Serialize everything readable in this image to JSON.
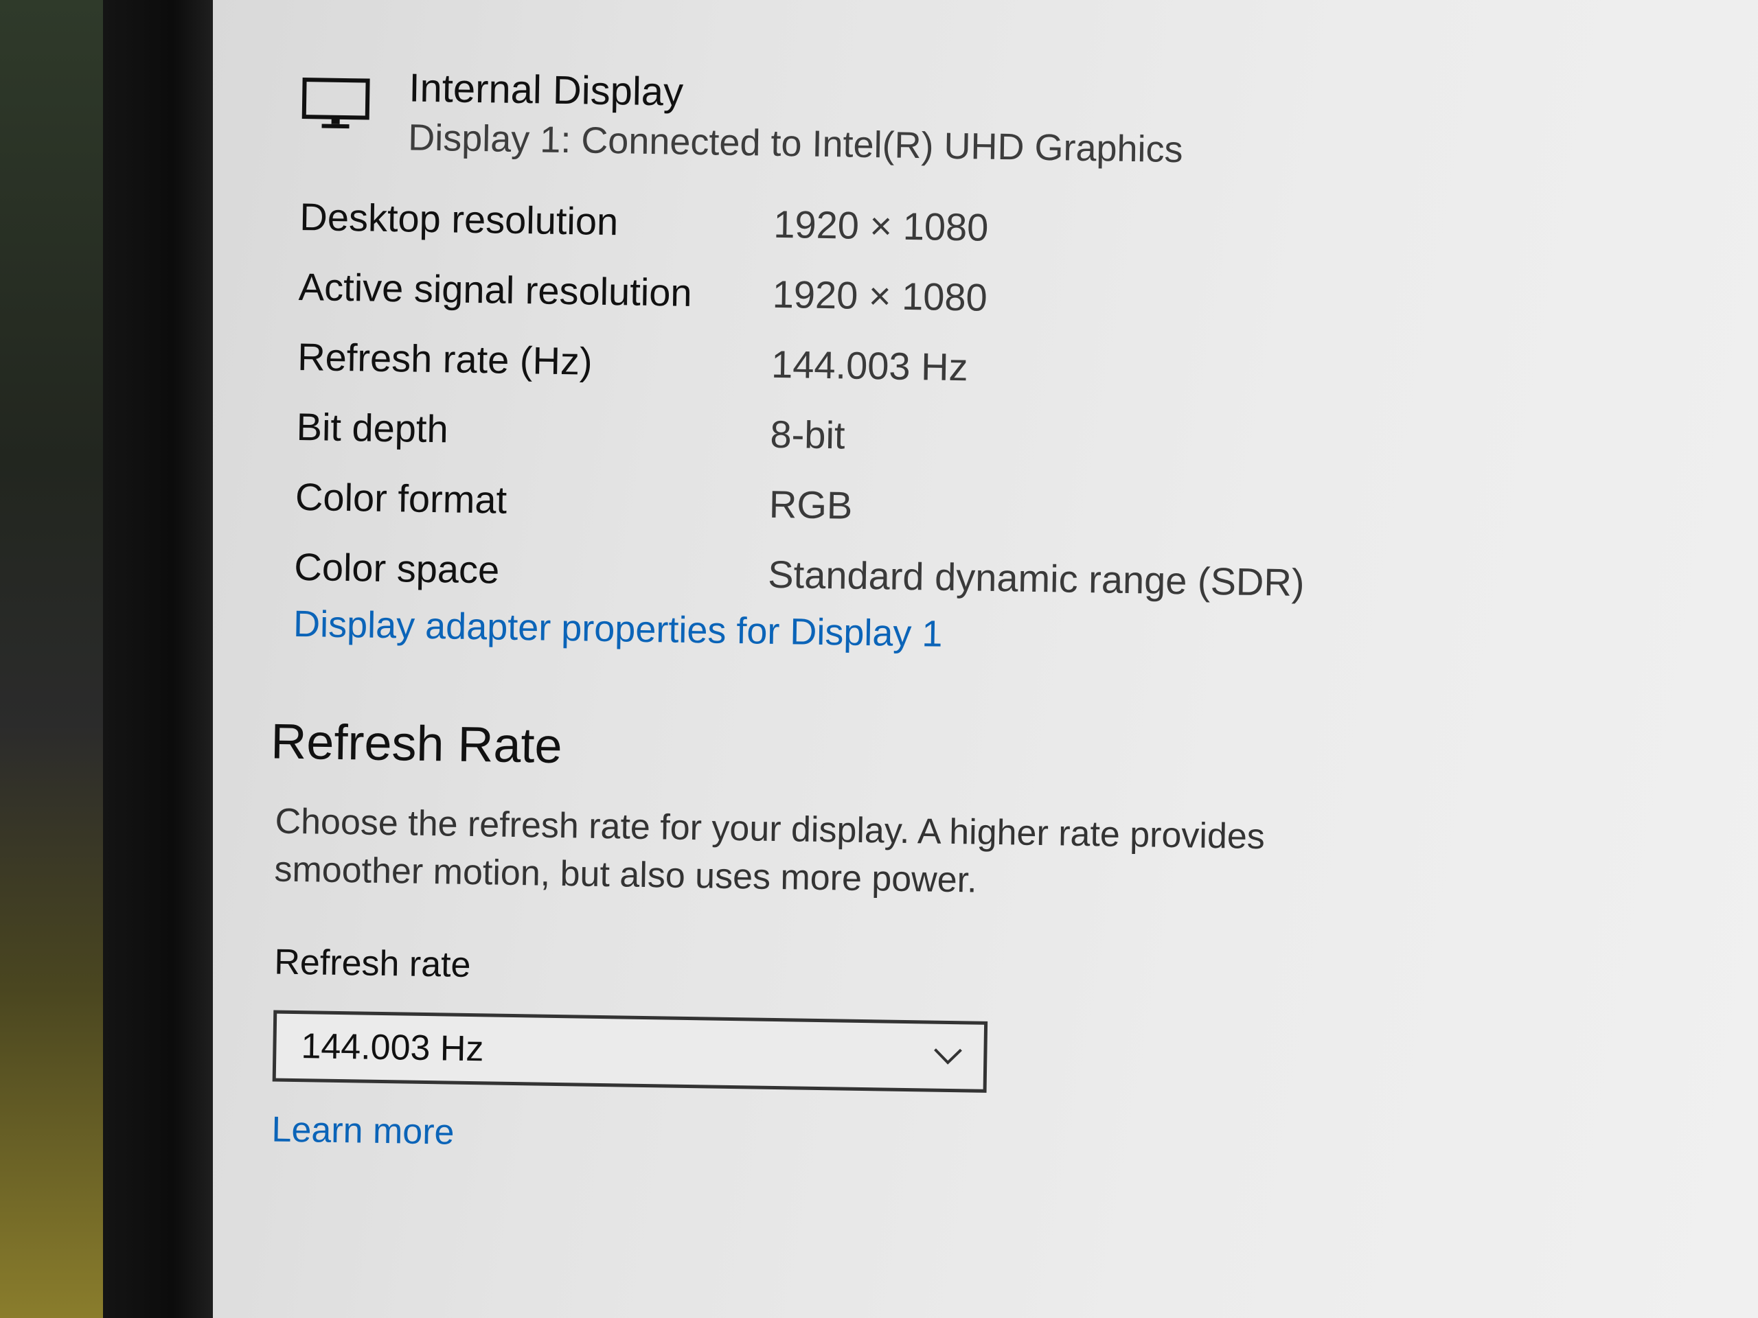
{
  "display": {
    "title": "Internal Display",
    "subtitle": "Display 1: Connected to Intel(R) UHD Graphics",
    "icon": "monitor-icon"
  },
  "properties": [
    {
      "label": "Desktop resolution",
      "value": "1920 × 1080"
    },
    {
      "label": "Active signal resolution",
      "value": "1920 × 1080"
    },
    {
      "label": "Refresh rate (Hz)",
      "value": "144.003 Hz"
    },
    {
      "label": "Bit depth",
      "value": "8-bit"
    },
    {
      "label": "Color format",
      "value": "RGB"
    },
    {
      "label": "Color space",
      "value": "Standard dynamic range (SDR)"
    }
  ],
  "adapter_link": "Display adapter properties for Display 1",
  "refresh_section": {
    "title": "Refresh Rate",
    "description": "Choose the refresh rate for your display. A higher rate provides smoother motion, but also uses more power.",
    "field_label": "Refresh rate",
    "selected_value": "144.003 Hz",
    "learn_more": "Learn more"
  },
  "colors": {
    "link": "#0b64b8",
    "background": "#e8e8e8",
    "text": "#111111"
  }
}
